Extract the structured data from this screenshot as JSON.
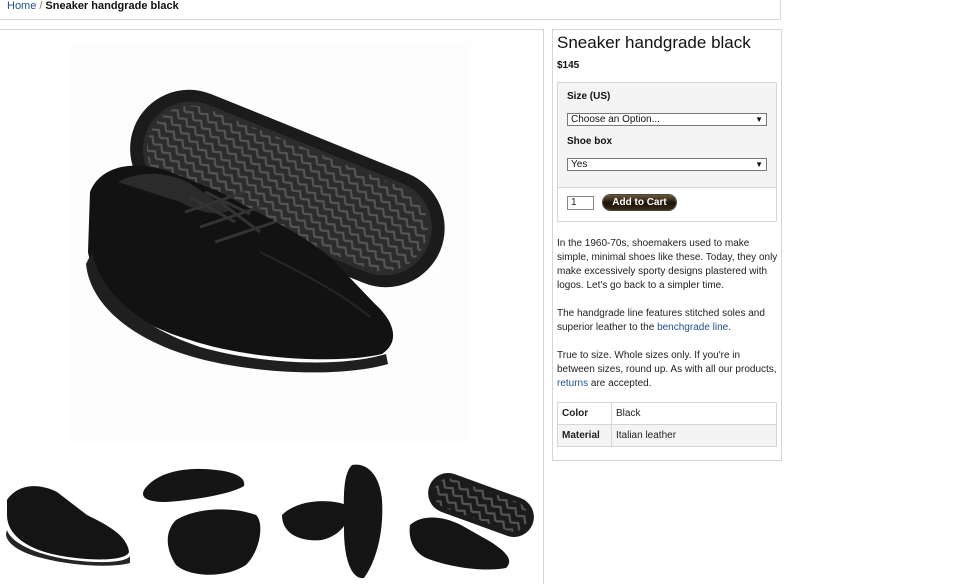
{
  "breadcrumb": {
    "home": "Home",
    "separator": "/",
    "current": "Sneaker handgrade black"
  },
  "product": {
    "title": "Sneaker handgrade black",
    "price": "$145",
    "options": {
      "size_label": "Size (US)",
      "size_value": "Choose an Option...",
      "box_label": "Shoe box",
      "box_value": "Yes"
    },
    "qty": "1",
    "add_to_cart": "Add to Cart",
    "description": {
      "p1": "In the 1960-70s, shoemakers used to make simple, minimal shoes like these. Today, they only make excessively sporty designs plastered with logos. Let's go back to a simpler time.",
      "p2_prefix": "The handgrade line features stitched soles and superior leather to the ",
      "p2_link": "benchgrade line",
      "p2_suffix": ".",
      "p3_prefix": "True to size. Whole sizes only. If you're in between sizes, round up. As with all our products, ",
      "p3_link": "returns",
      "p3_suffix": " are accepted."
    },
    "attributes": [
      {
        "name": "Color",
        "value": "Black"
      },
      {
        "name": "Material",
        "value": "Italian leather"
      }
    ]
  },
  "icons": {
    "dropdown": "triangle-down-icon"
  },
  "colors": {
    "link": "#1f4f8f",
    "border": "#d6d6d6",
    "panel_bg": "#f4f4f4",
    "button": "#2a1d0e"
  }
}
